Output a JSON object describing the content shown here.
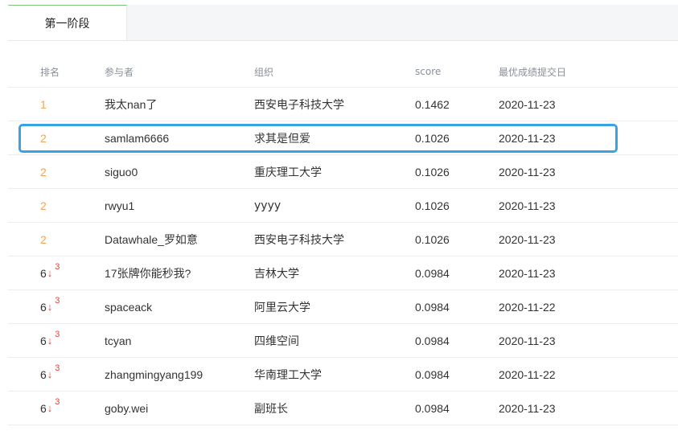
{
  "tabs": [
    {
      "label": "第一阶段"
    }
  ],
  "table": {
    "headers": {
      "rank": "排名",
      "participant": "参与者",
      "organization": "组织",
      "score": "score",
      "date": "最优成绩提交日"
    },
    "rows": [
      {
        "rank": "1",
        "change": "",
        "participant": "我太nan了",
        "organization": "西安电子科技大学",
        "score": "0.1462",
        "date": "2020-11-23"
      },
      {
        "rank": "2",
        "change": "",
        "participant": "samlam6666",
        "organization": "求其是但爱",
        "score": "0.1026",
        "date": "2020-11-23"
      },
      {
        "rank": "2",
        "change": "",
        "participant": "siguo0",
        "organization": "重庆理工大学",
        "score": "0.1026",
        "date": "2020-11-23"
      },
      {
        "rank": "2",
        "change": "",
        "participant": "rwyu1",
        "organization": "yyyy",
        "score": "0.1026",
        "date": "2020-11-23"
      },
      {
        "rank": "2",
        "change": "",
        "participant": "Datawhale_罗如意",
        "organization": "西安电子科技大学",
        "score": "0.1026",
        "date": "2020-11-23"
      },
      {
        "rank": "6",
        "change": "3",
        "participant": "17张牌你能秒我?",
        "organization": "吉林大学",
        "score": "0.0984",
        "date": "2020-11-23"
      },
      {
        "rank": "6",
        "change": "3",
        "participant": "spaceack",
        "organization": "阿里云大学",
        "score": "0.0984",
        "date": "2020-11-22"
      },
      {
        "rank": "6",
        "change": "3",
        "participant": "tcyan",
        "organization": "四维空间",
        "score": "0.0984",
        "date": "2020-11-23"
      },
      {
        "rank": "6",
        "change": "3",
        "participant": "zhangmingyang199",
        "organization": "华南理工大学",
        "score": "0.0984",
        "date": "2020-11-22"
      },
      {
        "rank": "6",
        "change": "3",
        "participant": "goby.wei",
        "organization": "副班长",
        "score": "0.0984",
        "date": "2020-11-23"
      }
    ]
  },
  "icons": {
    "rank_down": "arrow-down-icon"
  },
  "colors": {
    "top_rank": "#f0a35c",
    "rank_down": "#e0433b",
    "highlight": "#3aa3e3",
    "tab_accent": "#7ec27e"
  }
}
